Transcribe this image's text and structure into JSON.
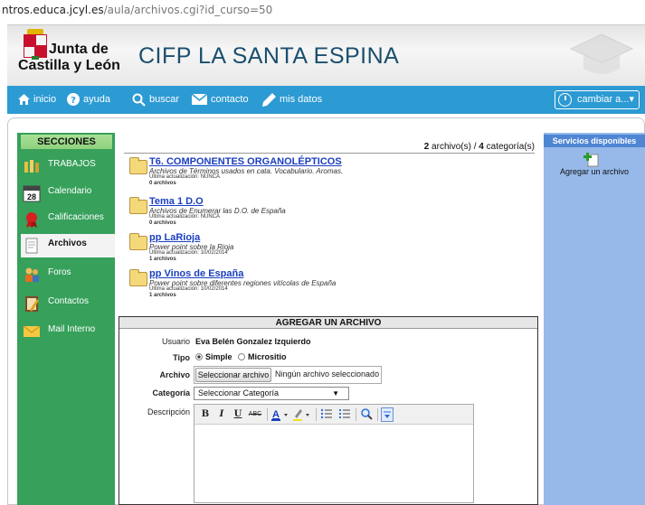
{
  "url": {
    "prefix": "ntros.educa.jcyl.es",
    "path": "/aula/archivos.cgi?id_curso=50"
  },
  "logo": {
    "line1": "Junta de",
    "line2": "Castilla y León"
  },
  "site_title": "CIFP LA SANTA ESPINA",
  "nav": {
    "items": [
      {
        "label": "inicio",
        "icon": "home-icon"
      },
      {
        "label": "ayuda",
        "icon": "help-icon"
      },
      {
        "label": "buscar",
        "icon": "search-icon"
      },
      {
        "label": "contacto",
        "icon": "mail-icon"
      },
      {
        "label": "mis datos",
        "icon": "pencil-icon"
      }
    ],
    "cambiar": "cambiar a...▾"
  },
  "sidebar": {
    "title": "SECCIONES",
    "items": [
      {
        "label": "TRABAJOS",
        "icon": "jobs-icon"
      },
      {
        "label": "Calendario",
        "icon": "calendar-icon",
        "icon_text": "28"
      },
      {
        "label": "Calificaciones",
        "icon": "grades-icon"
      },
      {
        "label": "Archivos",
        "icon": "files-icon",
        "active": true
      },
      {
        "label": "Foros",
        "icon": "forums-icon"
      },
      {
        "label": "Contactos",
        "icon": "contacts-icon"
      },
      {
        "label": "Mail Interno",
        "icon": "mail-icon"
      }
    ]
  },
  "main": {
    "counts": {
      "archivos": "2",
      "archivos_label": "archivo(s)",
      "sep": "/",
      "categorias": "4",
      "categorias_label": "categoría(s)"
    },
    "folders": [
      {
        "name": "T6. COMPONENTES ORGANOLÉPTICOS",
        "description": "Archivos de Términos usados en cata. Vocabulario. Aromas.",
        "updated": "Última actualización: NUNCA",
        "count": "0 archivos"
      },
      {
        "name": "Tema 1 D.O",
        "description": "Archivos de Enumerar las D.O. de España",
        "updated": "Última actualización: NUNCA",
        "count": "0 archivos"
      },
      {
        "name": "pp LaRioja",
        "description": "Power point sobre la Rioja",
        "updated": "Última actualización: 10/02/2014",
        "count": "1 archivos"
      },
      {
        "name": "pp Vinos de España",
        "description": "Power point sobre diferentes regiones vitícolas de España",
        "updated": "Última actualización: 10/02/2014",
        "count": "1 archivos"
      }
    ]
  },
  "add_form": {
    "title": "AGREGAR UN ARCHIVO",
    "usuario_label": "Usuario",
    "usuario_value": "Eva Belén Gonzalez Izquierdo",
    "tipo_label": "Tipo",
    "tipo_options": [
      "Simple",
      "Micrositio"
    ],
    "tipo_selected": "Simple",
    "archivo_label": "Archivo",
    "archivo_button": "Seleccionar archivo",
    "archivo_status": "Ningún archivo seleccionado",
    "categoria_label": "Categoría",
    "categoria_value": "Seleccionar Categoría",
    "descripcion_label": "Descripción",
    "toolbar": {
      "bold": "B",
      "italic": "I",
      "underline": "U",
      "strike": "ABC"
    }
  },
  "right": {
    "title": "Servicios disponibles",
    "add_label": "Agregar un archivo"
  },
  "colors": {
    "nav_blue": "#2c9ad3",
    "sidebar_green": "#37a05b",
    "right_blue": "#96b9e9",
    "link_blue": "#1a3ec0",
    "title_teal": "#1a4f6e"
  }
}
